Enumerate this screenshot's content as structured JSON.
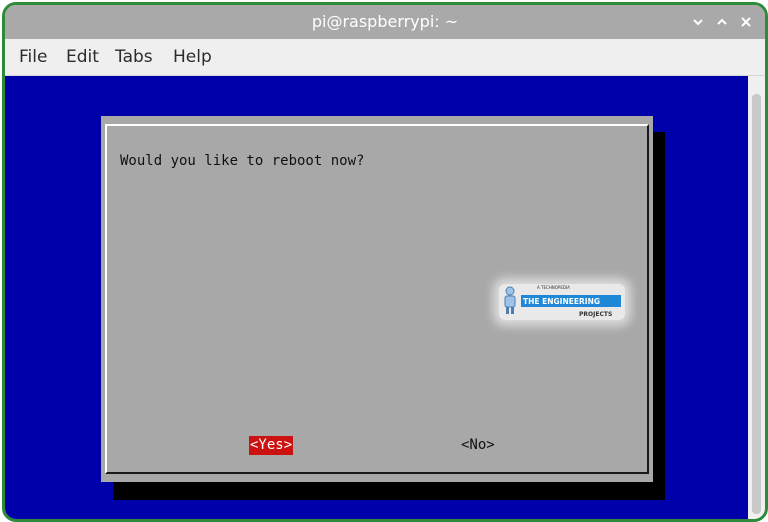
{
  "window": {
    "title": "pi@raspberrypi: ~",
    "minimize_icon": "chevron-down-icon",
    "maximize_icon": "chevron-up-icon",
    "close_icon": "close-icon"
  },
  "menubar": {
    "items": [
      "File",
      "Edit",
      "Tabs",
      "Help"
    ]
  },
  "dialog": {
    "prompt": "Would you like to reboot now?",
    "yes_label": "<Yes>",
    "no_label": "<No>",
    "selected": "yes"
  },
  "watermark": {
    "tagline": "A TECHNOPEDIA",
    "name_top": "THE ENGINEERING",
    "name_bottom": "PROJECTS"
  },
  "colors": {
    "terminal_bg": "#0000aa",
    "dialog_bg": "#a8a8a8",
    "selected_button_bg": "#cc1111",
    "frame_border": "#2e8b3a",
    "titlebar_bg": "#a9a9a9"
  }
}
